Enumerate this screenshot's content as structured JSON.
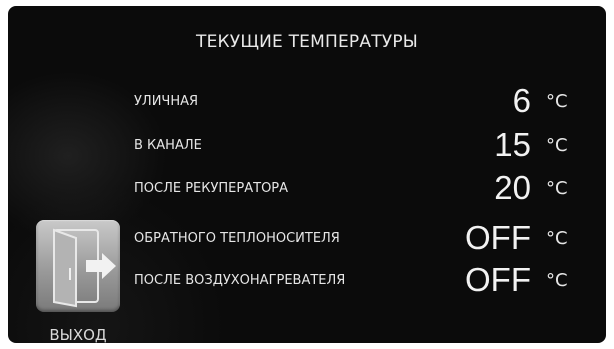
{
  "header": {
    "title": "ТЕКУЩИЕ ТЕМПЕРАТУРЫ"
  },
  "rows": [
    {
      "label": "УЛИЧНАЯ",
      "value": "6",
      "unit": "°C"
    },
    {
      "label": "В КАНАЛЕ",
      "value": "15",
      "unit": "°C"
    },
    {
      "label": "ПОСЛЕ РЕКУПЕРАТОРА",
      "value": "20",
      "unit": "°C"
    },
    {
      "label": "ОБРАТНОГО ТЕПЛОНОСИТЕЛЯ",
      "value": "OFF",
      "unit": "°C"
    },
    {
      "label": "ПОСЛЕ ВОЗДУХОНАГРЕВАТЕЛЯ",
      "value": "OFF",
      "unit": "°C"
    }
  ],
  "exit": {
    "label": "ВЫХОД",
    "icon": "exit-door-icon"
  },
  "colors": {
    "background": "#0b0b0b",
    "text": "#e6e6e6",
    "button": "#a8a8a8"
  }
}
